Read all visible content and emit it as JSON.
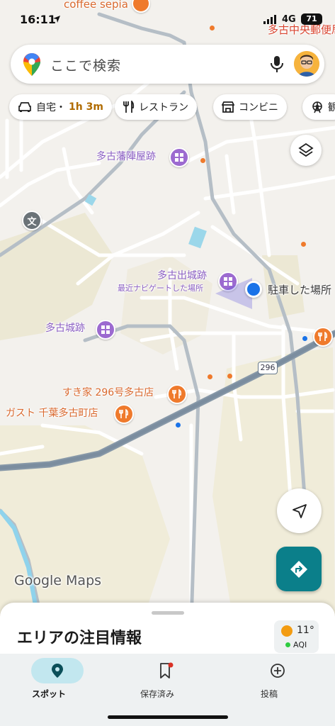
{
  "status_bar": {
    "time": "16:11",
    "network": "4G",
    "battery": "71"
  },
  "search": {
    "placeholder": "ここで検索"
  },
  "chips": [
    {
      "label": "自宅・",
      "eta": "1h 3m",
      "icon": "car-icon"
    },
    {
      "label": "レストラン",
      "icon": "restaurant-icon"
    },
    {
      "label": "コンビニ",
      "icon": "store-icon"
    },
    {
      "label": "観",
      "icon": "ferris-wheel-icon"
    }
  ],
  "map": {
    "labels": {
      "cafe": "coffee sepia",
      "post_office": "多古中央郵便局",
      "jinyaato": "多古藩陣屋跡",
      "dejo": "多古出城跡",
      "dejo_sub": "最近ナビゲートした場所",
      "parked": "駐車した場所",
      "castle": "多古城跡",
      "sukiya": "すき家 296号多古店",
      "gusto": "ガスト 千葉多古町店",
      "route": "296",
      "school_icon": "文"
    }
  },
  "watermark": "Google Maps",
  "sheet": {
    "title": "エリアの注目情報"
  },
  "weather": {
    "temp": "11°",
    "aqi": "AQI",
    "colors": {
      "sun": "#f39c12",
      "aqi": "#2ecc40"
    }
  },
  "nav": [
    {
      "label": "スポット",
      "icon": "location-pin-icon",
      "active": true
    },
    {
      "label": "保存済み",
      "icon": "bookmark-icon",
      "active": false
    },
    {
      "label": "投稿",
      "icon": "add-circle-icon",
      "active": false
    }
  ],
  "colors": {
    "accent": "#0b7f8a",
    "poi_purple": "#9c6ad0",
    "poi_orange": "#ef7a2c",
    "location_blue": "#1a73e8"
  }
}
